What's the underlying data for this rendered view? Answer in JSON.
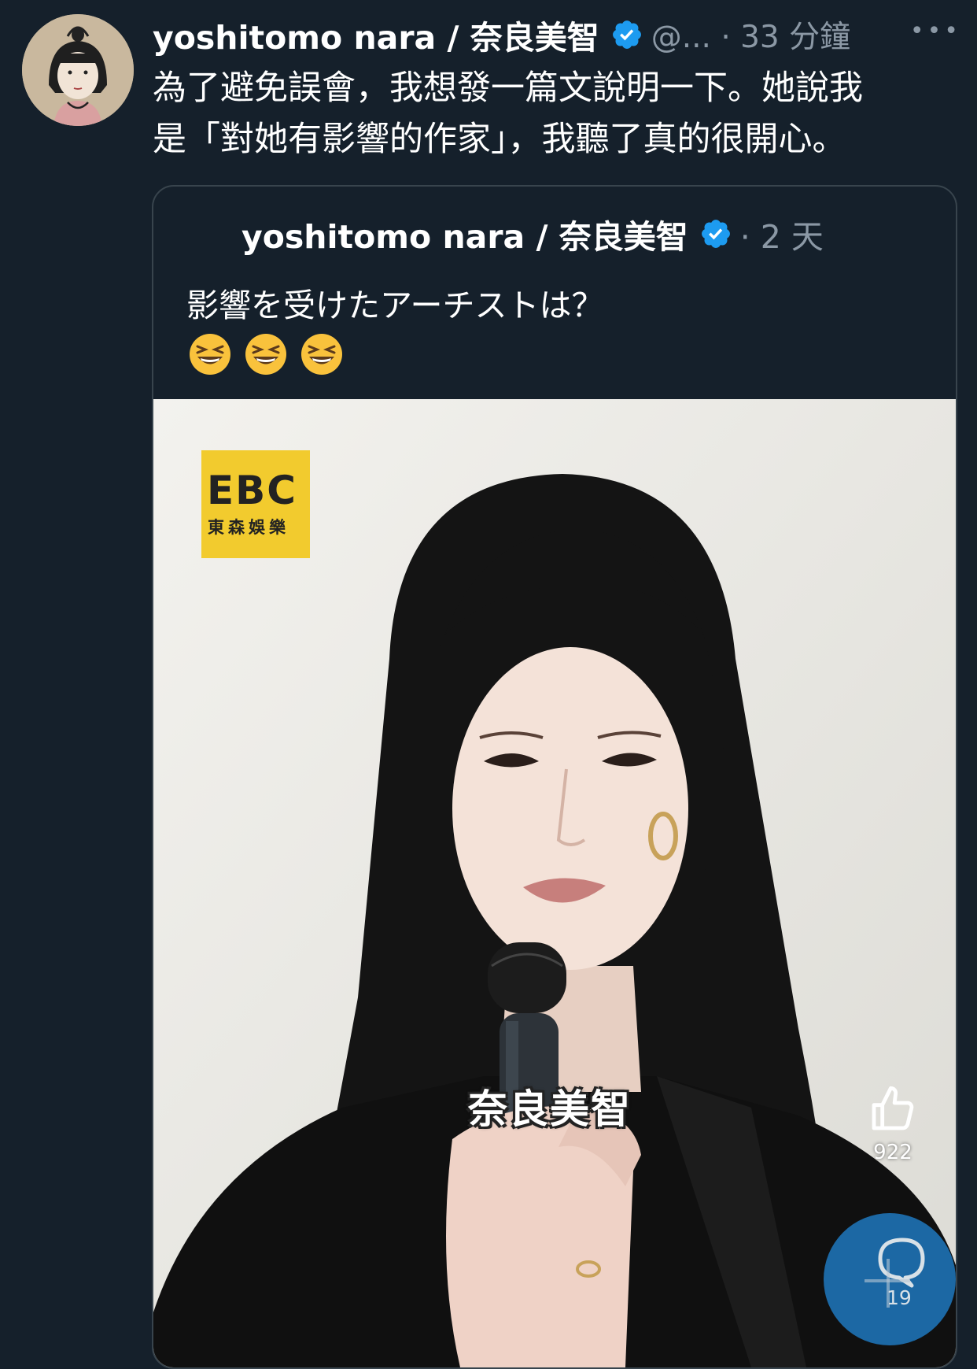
{
  "post": {
    "display_name": "yoshitomo nara / 奈良美智",
    "handle_time": "@... · 33 分鐘",
    "more_icon": "more-horizontal-icon",
    "text_lines": [
      "為了避免誤會，我想發一篇文說明一下。她說我",
      "是「對她有影響的作家」，我聽了真的很開心。"
    ]
  },
  "quoted_post": {
    "display_name": "yoshitomo nara / 奈良美智",
    "time": "· 2 天",
    "text": "影響を受けたアーチストは？",
    "emoji_name": "grinning-squinting-face-icon",
    "emoji_count": 3
  },
  "video": {
    "logo_main": "EBC",
    "logo_sub": "東森娛樂",
    "caption": "奈良美智",
    "like_count": "922"
  },
  "fab": {
    "count": "19",
    "icon": "compose-comment-icon"
  },
  "colors": {
    "background": "#15202b",
    "secondary_text": "#8b98a5",
    "verified": "#1d9bf0",
    "border": "#38444d",
    "fab": "#1d6fb0"
  }
}
